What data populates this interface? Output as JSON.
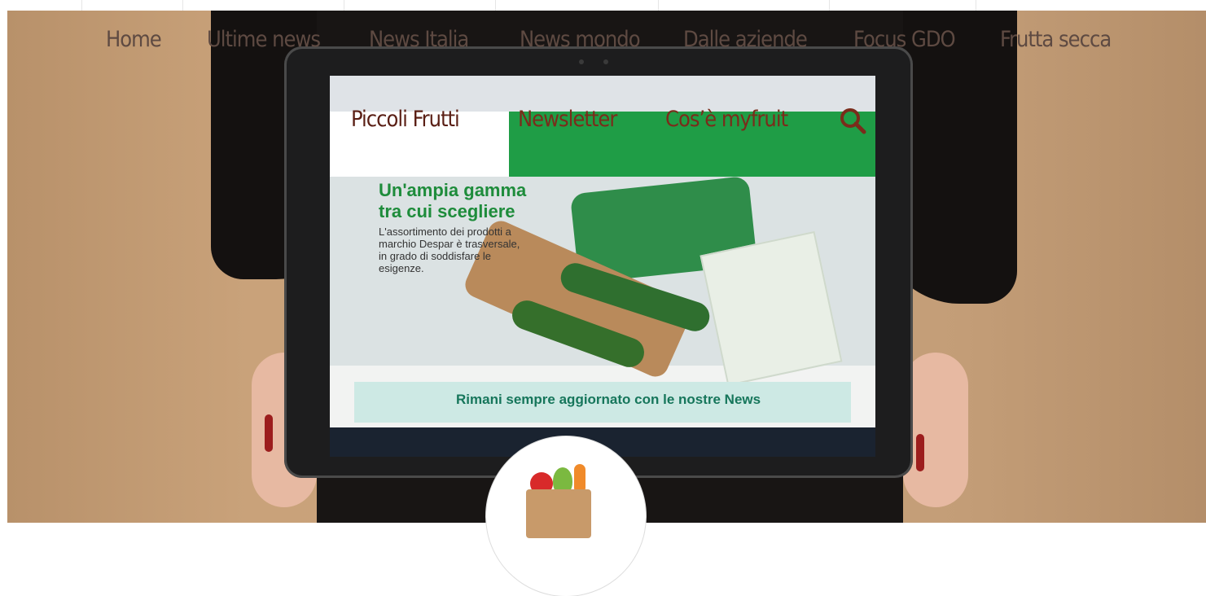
{
  "nav": {
    "items": [
      {
        "label": "Home"
      },
      {
        "label": "Ultime news"
      },
      {
        "label": "News Italia"
      },
      {
        "label": "News mondo"
      },
      {
        "label": "Dalle aziende"
      },
      {
        "label": "Focus GDO"
      },
      {
        "label": "Frutta secca"
      },
      {
        "label": "Piccoli Frutti"
      },
      {
        "label": "Newsletter"
      },
      {
        "label": "Cos’è myfruit"
      }
    ],
    "search_icon": "search-icon"
  },
  "hero": {
    "promo_headline_1": "Un'ampia gamma",
    "promo_headline_2": "tra cui scegliere",
    "promo_body": "L'assortimento dei prodotti a marchio Despar è trasversale, in grado di soddisfare le esigenze.",
    "news_banner": "Rimani sempre aggiornato con le nostre News"
  },
  "colors": {
    "nav_text": "#5e4a42",
    "nav_text_dark": "#5a1f15",
    "site_green": "#1f9d46"
  }
}
